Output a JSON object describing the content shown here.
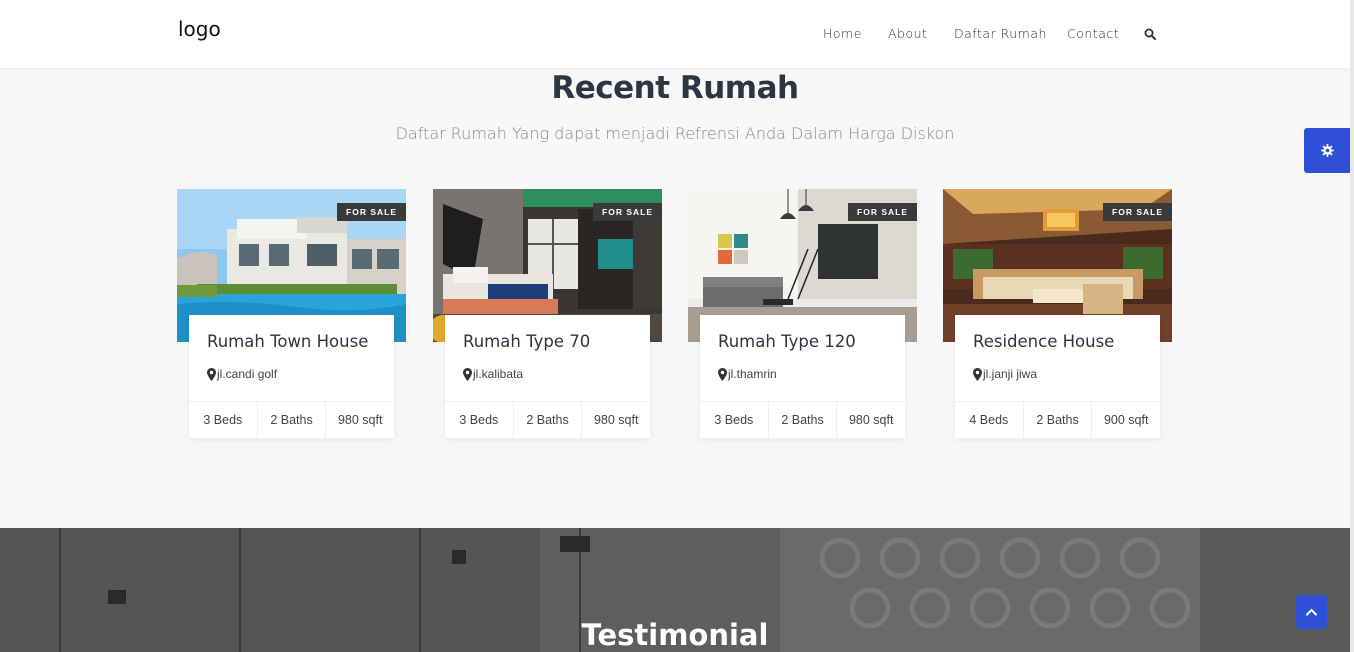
{
  "navbar": {
    "logo": "logo",
    "items": [
      {
        "label": "Home"
      },
      {
        "label": "About"
      },
      {
        "label": "Daftar Rumah"
      },
      {
        "label": "Contact"
      }
    ]
  },
  "section": {
    "title": "Recent Rumah",
    "subtitle": "Daftar Rumah Yang dapat menjadi Refrensi Anda Dalam Harga Diskon"
  },
  "properties": [
    {
      "badge": "FOR SALE",
      "title": "Rumah Town House",
      "location": "jl.candi golf",
      "beds": "3 Beds",
      "baths": "2 Baths",
      "area": "980 sqft"
    },
    {
      "badge": "FOR SALE",
      "title": "Rumah Type 70",
      "location": "jl.kalibata",
      "beds": "3 Beds",
      "baths": "2 Baths",
      "area": "980 sqft"
    },
    {
      "badge": "FOR SALE",
      "title": "Rumah Type 120",
      "location": "jl.thamrin",
      "beds": "3 Beds",
      "baths": "2 Baths",
      "area": "980 sqft"
    },
    {
      "badge": "FOR SALE",
      "title": "Residence House",
      "location": "jl.janji jiwa",
      "beds": "4 Beds",
      "baths": "2 Baths",
      "area": "900 sqft"
    }
  ],
  "testimonial": {
    "title": "Testimonial"
  },
  "colors": {
    "accent": "#2f4fd6",
    "heading": "#2d3542"
  },
  "icons": {
    "search": "search-icon",
    "settings": "gear-icon",
    "location": "map-marker-icon",
    "back_to_top": "chevron-up-icon"
  }
}
